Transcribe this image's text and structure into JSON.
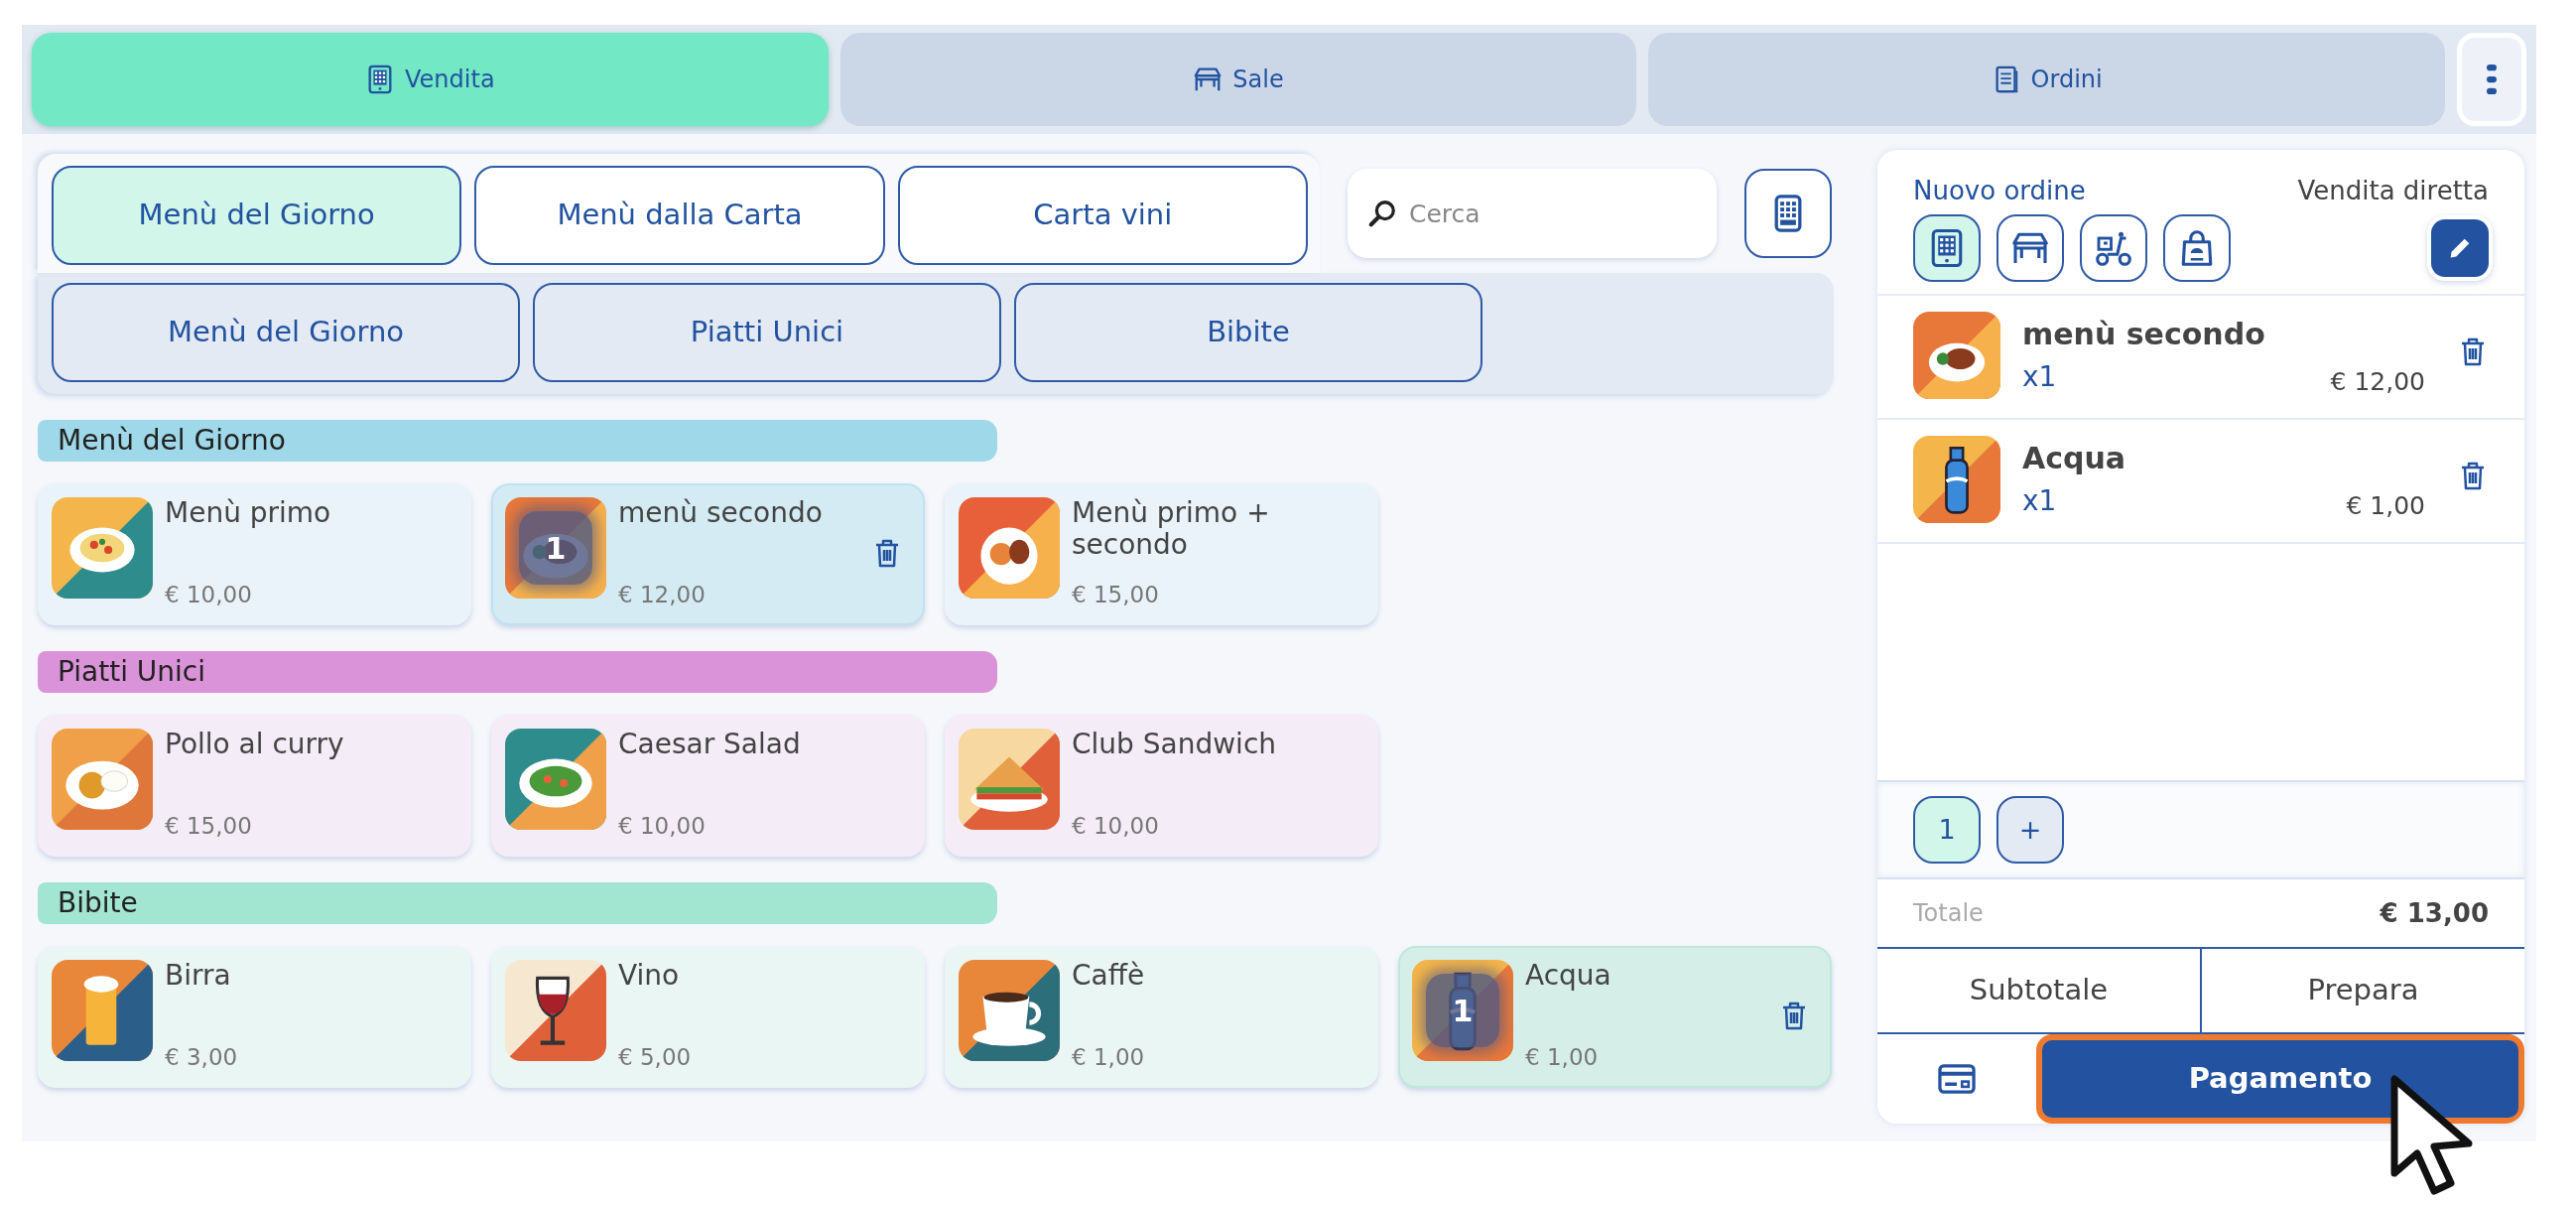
{
  "top_tabs": [
    {
      "label": "Vendita",
      "selected": true
    },
    {
      "label": "Sale",
      "selected": false
    },
    {
      "label": "Ordini",
      "selected": false
    }
  ],
  "menus": [
    {
      "label": "Menù del Giorno",
      "selected": true
    },
    {
      "label": "Menù dalla Carta",
      "selected": false
    },
    {
      "label": "Carta vini",
      "selected": false
    }
  ],
  "search": {
    "placeholder": "Cerca"
  },
  "categories": [
    {
      "label": "Menù del Giorno"
    },
    {
      "label": "Piatti Unici"
    },
    {
      "label": "Bibite"
    }
  ],
  "sections": [
    {
      "title": "Menù del Giorno",
      "color": "#9fd8e8",
      "products": [
        {
          "name": "Menù primo",
          "price": "€ 10,00",
          "selected": false
        },
        {
          "name": "menù secondo",
          "price": "€ 12,00",
          "selected": true,
          "count": "1"
        },
        {
          "name": "Menù primo + secondo",
          "price": "€ 15,00",
          "selected": false
        }
      ]
    },
    {
      "title": "Piatti Unici",
      "color": "#da92d9",
      "products": [
        {
          "name": "Pollo al curry",
          "price": "€ 15,00",
          "selected": false
        },
        {
          "name": "Caesar Salad",
          "price": "€ 10,00",
          "selected": false
        },
        {
          "name": "Club Sandwich",
          "price": "€ 10,00",
          "selected": false
        }
      ]
    },
    {
      "title": "Bibite",
      "color": "#a2e5d0",
      "products": [
        {
          "name": "Birra",
          "price": "€ 3,00",
          "selected": false
        },
        {
          "name": "Vino",
          "price": "€ 5,00",
          "selected": false
        },
        {
          "name": "Caffè",
          "price": "€ 1,00",
          "selected": false
        },
        {
          "name": "Acqua",
          "price": "€ 1,00",
          "selected": true,
          "count": "1"
        }
      ]
    }
  ],
  "order": {
    "title": "Nuovo ordine",
    "mode": "Vendita diretta",
    "types": [
      {
        "selected": true
      },
      {
        "selected": false
      },
      {
        "selected": false
      },
      {
        "selected": false
      }
    ],
    "items": [
      {
        "name": "menù secondo",
        "qty": "x1",
        "price": "€ 12,00"
      },
      {
        "name": "Acqua",
        "qty": "x1",
        "price": "€ 1,00"
      }
    ],
    "keypad": [
      {
        "label": "1",
        "selected": true
      },
      {
        "label": "+",
        "selected": false
      }
    ],
    "total_label": "Totale",
    "total": "€ 13,00",
    "actions": [
      "Subtotale",
      "Prepara"
    ],
    "pay": "Pagamento"
  }
}
